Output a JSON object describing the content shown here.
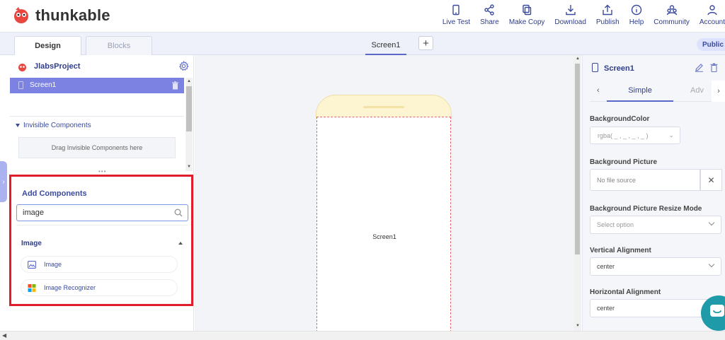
{
  "brand": {
    "name": "thunkable"
  },
  "nav": [
    {
      "label": "Live Test",
      "icon": "phone-icon"
    },
    {
      "label": "Share",
      "icon": "share-icon"
    },
    {
      "label": "Make Copy",
      "icon": "copy-icon"
    },
    {
      "label": "Download",
      "icon": "download-icon"
    },
    {
      "label": "Publish",
      "icon": "publish-icon"
    },
    {
      "label": "Help",
      "icon": "help-icon"
    },
    {
      "label": "Community",
      "icon": "community-icon"
    },
    {
      "label": "Account",
      "icon": "account-icon"
    }
  ],
  "tabs": {
    "design": "Design",
    "blocks": "Blocks"
  },
  "screen_tab": "Screen1",
  "add_screen": "+",
  "visibility_badge": "Public",
  "project": {
    "name": "JlabsProject"
  },
  "screens": [
    {
      "label": "Screen1"
    }
  ],
  "invisible": {
    "title": "Invisible Components",
    "drag_hint": "Drag Invisible Components here"
  },
  "add_components": {
    "title": "Add Components",
    "search_value": "image",
    "category": "Image",
    "items": [
      {
        "label": "Image",
        "icon": "image-icon"
      },
      {
        "label": "Image Recognizer",
        "icon": "microsoft-logo-icon"
      }
    ]
  },
  "canvas": {
    "screen_label": "Screen1"
  },
  "properties": {
    "component_name": "Screen1",
    "tabs": {
      "simple": "Simple",
      "advanced": "Adv"
    },
    "background_color": {
      "label": "BackgroundColor",
      "value": "rgba( _ , _ , _ , _ )"
    },
    "background_picture": {
      "label": "Background Picture",
      "value": "No file source"
    },
    "resize_mode": {
      "label": "Background Picture Resize Mode",
      "placeholder": "Select option"
    },
    "vertical_alignment": {
      "label": "Vertical Alignment",
      "value": "center"
    },
    "horizontal_alignment": {
      "label": "Horizontal Alignment",
      "value": "center"
    }
  },
  "colors": {
    "accent": "#7b82e2",
    "brand_text": "#2f3d8a",
    "highlight_border": "#e01e2b",
    "chat": "#1e9aa8"
  }
}
